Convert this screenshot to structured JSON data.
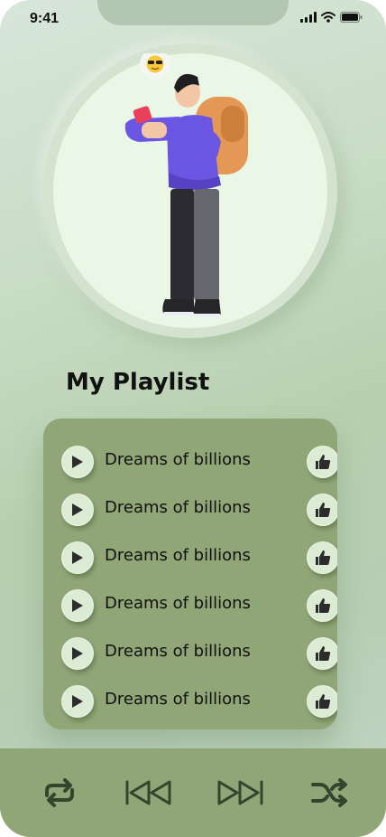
{
  "status_bar": {
    "time": "9:41",
    "icons": [
      "signal-icon",
      "wifi-icon",
      "battery-icon"
    ]
  },
  "hero": {
    "illustration": "person-with-phone-and-backpack",
    "emoji": "sunglasses-emoji"
  },
  "playlist": {
    "title": "My Playlist",
    "songs": [
      {
        "title": "Dreams of billions"
      },
      {
        "title": "Dreams of billions"
      },
      {
        "title": "Dreams of billions"
      },
      {
        "title": "Dreams of billions"
      },
      {
        "title": "Dreams of billions"
      },
      {
        "title": "Dreams of billions"
      }
    ]
  },
  "player_controls": [
    "repeat-icon",
    "previous-icon",
    "next-icon",
    "shuffle-icon"
  ],
  "colors": {
    "background": "#c9dcc6",
    "panel": "#91a676",
    "button": "#dcebd3",
    "icon": "#34452e"
  }
}
